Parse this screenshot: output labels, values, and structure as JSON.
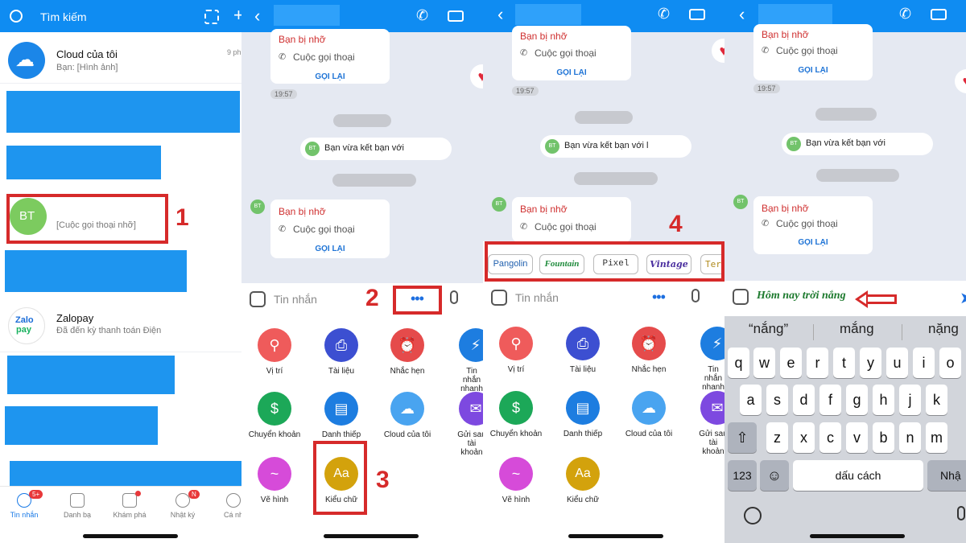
{
  "panel1": {
    "search_placeholder": "Tìm kiếm",
    "conversations": [
      {
        "name": "Cloud của tôi",
        "preview": "Bạn: [Hình ảnh]",
        "time": "9 ph"
      },
      {
        "initials": "BT",
        "preview": "[Cuộc gọi thoại nhỡ]"
      },
      {
        "name": "Zalopay",
        "preview": "Đã đến kỳ thanh toán Điện",
        "logo_line1": "Zalo",
        "logo_line2": "pay"
      }
    ],
    "tabs": [
      {
        "label": "Tin nhắn",
        "badge": "5+"
      },
      {
        "label": "Danh bạ"
      },
      {
        "label": "Khám phá"
      },
      {
        "label": "Nhật ký",
        "badge": "N"
      },
      {
        "label": "Cá nh"
      }
    ],
    "step": "1"
  },
  "chat": {
    "missed_call_title": "Bạn bị nhỡ",
    "missed_call_sub": "Cuộc gọi thoại",
    "call_back": "GỌI LẠI",
    "time": "19:57",
    "friend_msg": "Bạn vừa kết bạn với",
    "friend_msg_p3": "Bạn vừa kết bạn với l",
    "avatar_initials": "BT",
    "input_placeholder": "Tin nhắn",
    "more_dots": "•••",
    "heart": "♥"
  },
  "tray": {
    "row1": [
      {
        "label": "Vị trí",
        "icon": "location-icon",
        "color": "#ef5b5b",
        "glyph": "⚲"
      },
      {
        "label": "Tài liệu",
        "icon": "document-icon",
        "color": "#3c4fd1",
        "glyph": "⎙"
      },
      {
        "label": "Nhắc hẹn",
        "icon": "alarm-icon",
        "color": "#e54b4b",
        "glyph": "⏰"
      },
      {
        "label": "Tin nhắn nhanh",
        "icon": "quick-message-icon",
        "color": "#1d7de0",
        "glyph": "⚡"
      }
    ],
    "row2": [
      {
        "label": "Chuyển khoản",
        "icon": "transfer-icon",
        "color": "#1ca858",
        "glyph": "$"
      },
      {
        "label": "Danh thiếp",
        "icon": "business-card-icon",
        "color": "#1d7de0",
        "glyph": "▤"
      },
      {
        "label": "Cloud của tôi",
        "icon": "cloud-icon",
        "color": "#49a4f0",
        "glyph": "☁"
      },
      {
        "label": "Gửi sau tài khoản",
        "icon": "send-later-icon",
        "color": "#7d49e0",
        "glyph": "✉"
      }
    ],
    "row3": [
      {
        "label": "Vẽ hình",
        "icon": "draw-icon",
        "color": "#d64bd9",
        "glyph": "~"
      },
      {
        "label": "Kiểu chữ",
        "icon": "font-style-icon",
        "color": "#d3a20c",
        "glyph": "Aa"
      }
    ]
  },
  "steps": {
    "s2": "2",
    "s3": "3",
    "s4": "4"
  },
  "fonts": [
    "Pangolin",
    "Fountain",
    "Pixel",
    "Vintage",
    "Term"
  ],
  "panel4": {
    "typed_text": "Hôm nay trời nắng",
    "suggestions": [
      "“nắng”",
      "mắng",
      "nặng"
    ],
    "keyboard": {
      "row1": [
        "q",
        "w",
        "e",
        "r",
        "t",
        "y",
        "u",
        "i",
        "o"
      ],
      "row2": [
        "a",
        "s",
        "d",
        "f",
        "g",
        "h",
        "j",
        "k"
      ],
      "row3": [
        "z",
        "x",
        "c",
        "v",
        "b",
        "n",
        "m"
      ],
      "numbers": "123",
      "space": "dấu cách",
      "return_partial": "Nhậ"
    }
  }
}
